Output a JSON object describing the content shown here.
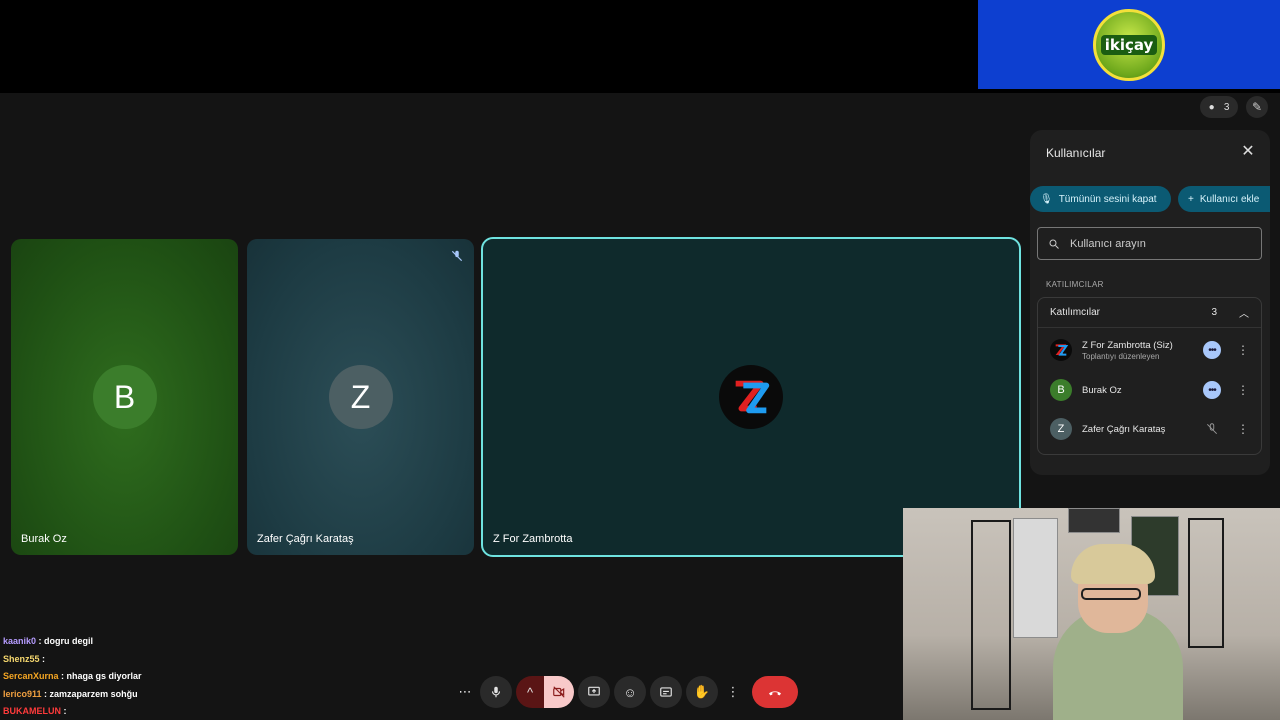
{
  "sponsor": {
    "brand_text": "ikiçay"
  },
  "top_icons": {
    "people_count": "3"
  },
  "tiles": [
    {
      "name": "Burak Oz",
      "initial": "B"
    },
    {
      "name": "Zafer Çağrı Karataş",
      "initial": "Z"
    },
    {
      "name": "Z For Zambrotta"
    }
  ],
  "panel": {
    "title": "Kullanıcılar",
    "mute_all_label": "Tümünün sesini kapat",
    "add_user_label": "Kullanıcı ekle",
    "search_placeholder": "Kullanıcı arayın",
    "section_label": "KATILIMCILAR",
    "group": {
      "label": "Katılımcılar",
      "count": "3",
      "people": [
        {
          "name": "Z For Zambrotta (Siz)",
          "subtitle": "Toplantıyı düzenleyen",
          "initial": "Z"
        },
        {
          "name": "Burak Oz",
          "subtitle": "",
          "initial": "B"
        },
        {
          "name": "Zafer Çağrı Karataş",
          "subtitle": "",
          "initial": "Z"
        }
      ]
    }
  },
  "chat": [
    {
      "user": "kaanik0",
      "message": ": dogru degil",
      "color": "#b69cff"
    },
    {
      "user": "Shenz55",
      "message": ":",
      "color": "#f5d76e"
    },
    {
      "user": "SercanXurna",
      "message": ": nhaga gs diyorlar",
      "color": "#f5a623"
    },
    {
      "user": "Ierico911",
      "message": ": zamzaparzem sohğu",
      "color": "#f0a040"
    },
    {
      "user": "BUKAMELUN",
      "message": ":",
      "color": "#ff3b3b"
    }
  ],
  "colors": {
    "accent_border": "#6fe3e0",
    "end_call": "#dc3434",
    "panel_button": "#0b5a73"
  }
}
